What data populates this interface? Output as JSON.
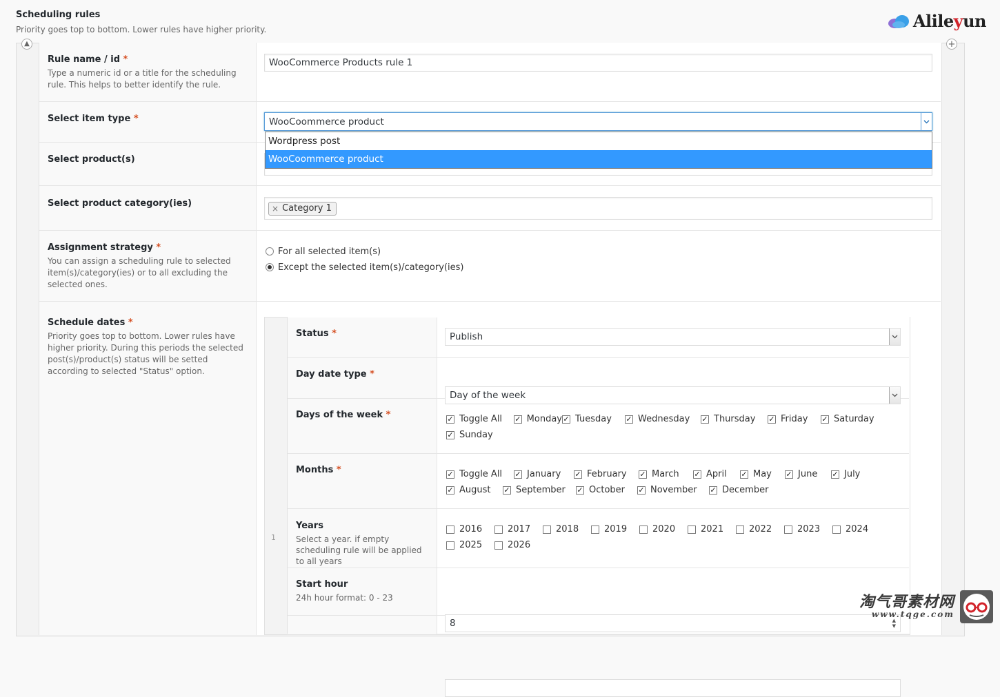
{
  "header": {
    "title": "Scheduling rules",
    "subtitle": "Priority goes top to bottom. Lower rules have higher priority."
  },
  "logo": {
    "brand_prefix": "Alile",
    "brand_accent": "y",
    "brand_suffix": "un"
  },
  "rule": {
    "index": "1",
    "name": {
      "label": "Rule name / id",
      "required": "*",
      "description": "Type a numeric id or a title for the scheduling rule. This helps to better identify the rule.",
      "value": "WooCommerce Products rule 1"
    },
    "item_type": {
      "label": "Select item type",
      "required": "*",
      "selected": "WooCoommerce product",
      "options": [
        "Wordpress post",
        "WooCoommerce product"
      ]
    },
    "products": {
      "label": "Select product(s)"
    },
    "categories": {
      "label": "Select product category(ies)",
      "tokens": [
        "Category 1"
      ]
    },
    "strategy": {
      "label": "Assignment strategy",
      "required": "*",
      "description": "You can assign a scheduling rule to selected item(s)/category(ies) or to all excluding the selected ones.",
      "options": [
        "For all selected item(s)",
        "Except the selected item(s)/category(ies)"
      ],
      "selected_index": 1
    },
    "schedule_dates": {
      "label": "Schedule dates",
      "required": "*",
      "description": "Priority goes top to bottom. Lower rules have higher priority. During this periods the selected post(s)/product(s) status will be setted according to selected \"Status\" option."
    }
  },
  "schedule": {
    "status": {
      "label": "Status",
      "required": "*",
      "value": "Publish"
    },
    "day_date_type": {
      "label": "Day date type",
      "required": "*",
      "value": "Day of the week"
    },
    "days_of_week": {
      "label": "Days of the week",
      "required": "*",
      "items": [
        {
          "label": "Toggle All",
          "checked": true
        },
        {
          "label": "Monday",
          "checked": true
        },
        {
          "label": "Tuesday",
          "checked": true
        },
        {
          "label": "Wednesday",
          "checked": true
        },
        {
          "label": "Thursday",
          "checked": true
        },
        {
          "label": "Friday",
          "checked": true
        },
        {
          "label": "Saturday",
          "checked": true
        },
        {
          "label": "Sunday",
          "checked": true
        }
      ]
    },
    "months": {
      "label": "Months",
      "required": "*",
      "items": [
        {
          "label": "Toggle All",
          "checked": true
        },
        {
          "label": "January",
          "checked": true
        },
        {
          "label": "February",
          "checked": true
        },
        {
          "label": "March",
          "checked": true
        },
        {
          "label": "April",
          "checked": true
        },
        {
          "label": "May",
          "checked": true
        },
        {
          "label": "June",
          "checked": true
        },
        {
          "label": "July",
          "checked": true
        },
        {
          "label": "August",
          "checked": true
        },
        {
          "label": "September",
          "checked": true
        },
        {
          "label": "October",
          "checked": true
        },
        {
          "label": "November",
          "checked": true
        },
        {
          "label": "December",
          "checked": true
        }
      ]
    },
    "years": {
      "label": "Years",
      "description": "Select a year. if empty scheduling rule will be applied to all years",
      "items": [
        {
          "label": "2016",
          "checked": false
        },
        {
          "label": "2017",
          "checked": false
        },
        {
          "label": "2018",
          "checked": false
        },
        {
          "label": "2019",
          "checked": false
        },
        {
          "label": "2020",
          "checked": false
        },
        {
          "label": "2021",
          "checked": false
        },
        {
          "label": "2022",
          "checked": false
        },
        {
          "label": "2023",
          "checked": false
        },
        {
          "label": "2024",
          "checked": false
        },
        {
          "label": "2025",
          "checked": false
        },
        {
          "label": "2026",
          "checked": false
        }
      ]
    },
    "start_hour": {
      "label": "Start hour",
      "description": "24h hour format: 0 - 23",
      "value": "8"
    }
  },
  "watermark": {
    "text": "淘气哥素材网",
    "url": "www.tqge.com"
  },
  "colors": {
    "selected_option_bg": "#3399ff",
    "required_mark": "#d54e21",
    "logo_accent": "#d2232a"
  }
}
